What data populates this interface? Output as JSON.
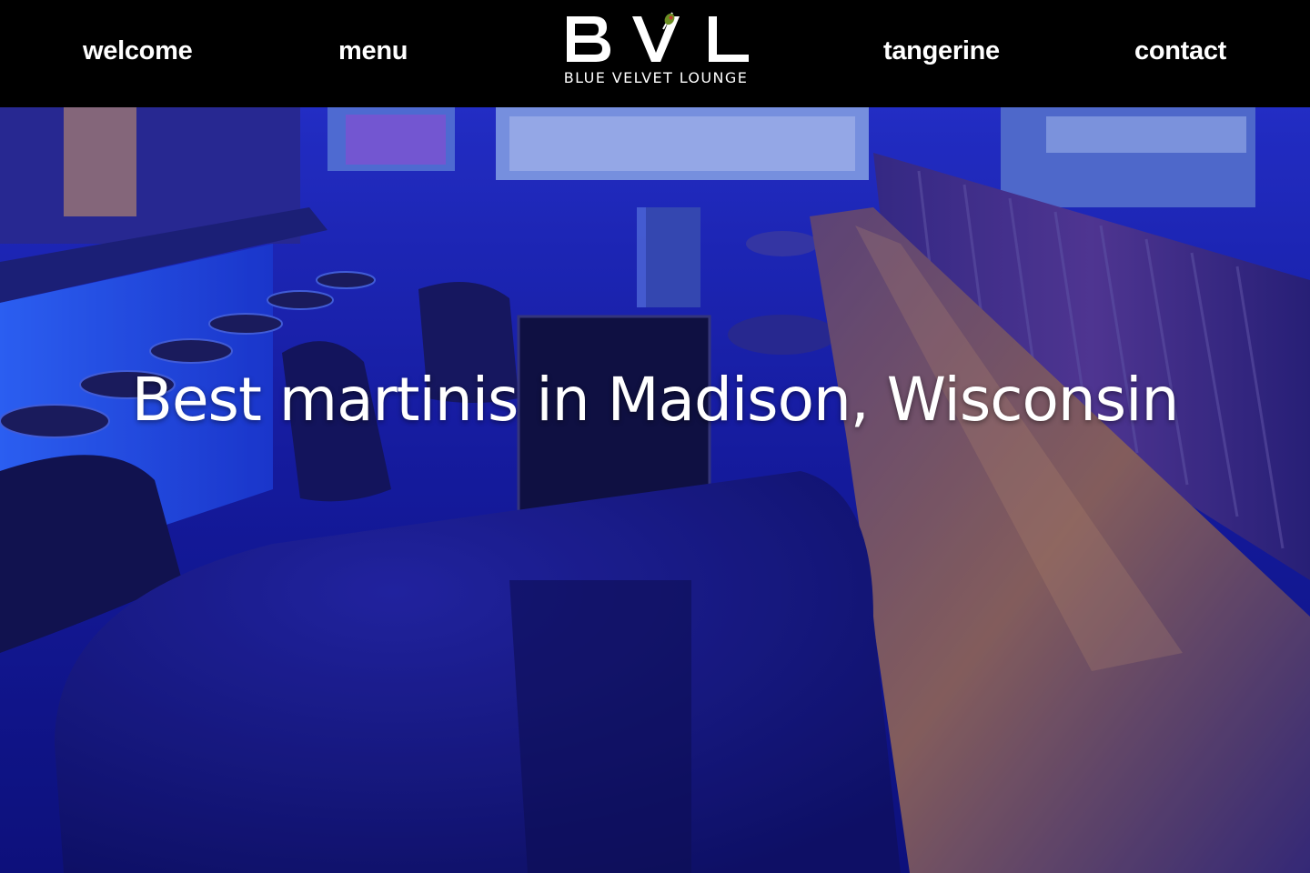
{
  "nav": {
    "left_items": [
      {
        "label": "welcome"
      },
      {
        "label": "menu"
      }
    ],
    "right_items": [
      {
        "label": "tangerine"
      },
      {
        "label": "contact"
      }
    ]
  },
  "logo": {
    "mark": "BVL",
    "subtitle": "BLUE VELVET LOUNGE",
    "accent_icon": "martini-olive-icon"
  },
  "hero": {
    "headline": "Best martinis in Madison, Wisconsin",
    "background_image": "blue-lit-lounge-interior-photo"
  },
  "colors": {
    "header_bg": "#000000",
    "text": "#ffffff",
    "hero_tint": "#1a1fb0",
    "olive_accent": "#6b8e23",
    "pimento_accent": "#c0392b"
  }
}
